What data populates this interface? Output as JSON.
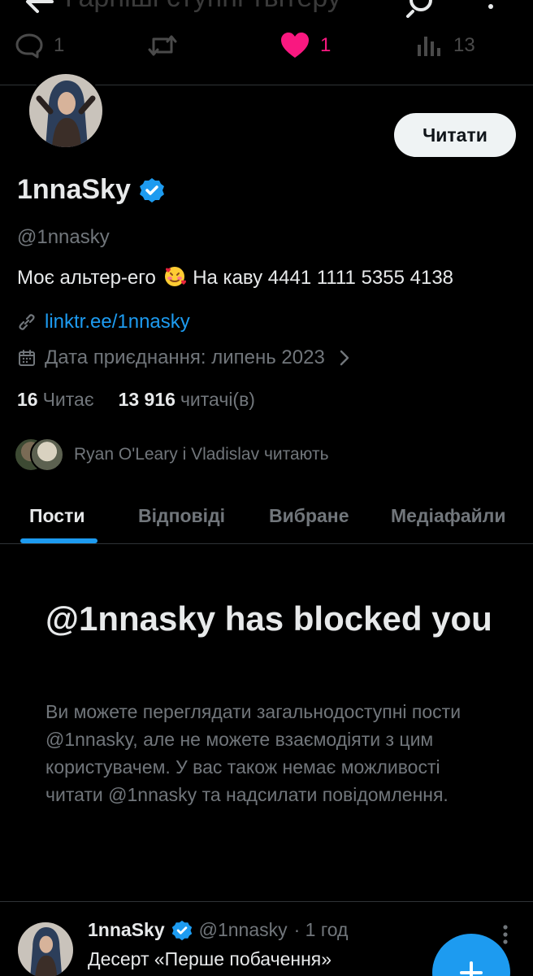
{
  "top_bar": {
    "faded_text": "Гарніші ступні твітеру"
  },
  "action_bar": {
    "replies": "1",
    "retweets": "",
    "likes": "1",
    "views": "13"
  },
  "profile": {
    "follow_button": "Читати",
    "display_name": "1nnaSky",
    "handle": "@1nnasky",
    "bio_before_emoji": "Моє альтер-его",
    "bio_emoji": "smiling-face-with-hearts",
    "bio_after_emoji": "На каву 4441 1111 5355 4138",
    "link": "linktr.ee/1nnasky",
    "joined": "Дата приєднання: липень 2023",
    "following_count": "16",
    "following_label": "Читає",
    "followers_count": "13 916",
    "followers_label": "читачі(в)",
    "known_followers": "Ryan O'Leary і Vladislav читають"
  },
  "tabs": [
    {
      "label": "Пости",
      "active": true
    },
    {
      "label": "Відповіді",
      "active": false
    },
    {
      "label": "Вибране",
      "active": false
    },
    {
      "label": "Медіафайли",
      "active": false
    }
  ],
  "blocked": {
    "title": "@1nnasky has blocked you",
    "message": "Ви можете переглядати загальнодоступні пости @1nnasky, але не можете взаємодіяти з цим користувачем. У вас також немає можливості читати @1nnasky та надсилати повідомлення."
  },
  "post": {
    "name": "1nnaSky",
    "handle": "@1nnasky",
    "time": "· 1 год",
    "text": "Десерт «Перше побачення»"
  },
  "colors": {
    "accent": "#1d9bf0",
    "like": "#f91880",
    "muted": "#71767b",
    "text": "#e7e9ea",
    "background": "#000000"
  },
  "icons": [
    "back-arrow-icon",
    "search-icon",
    "more-vertical-icon",
    "reply-icon",
    "retweet-icon",
    "heart-icon",
    "views-icon",
    "verified-badge-icon",
    "link-icon",
    "calendar-icon",
    "chevron-right-icon",
    "plus-icon"
  ]
}
